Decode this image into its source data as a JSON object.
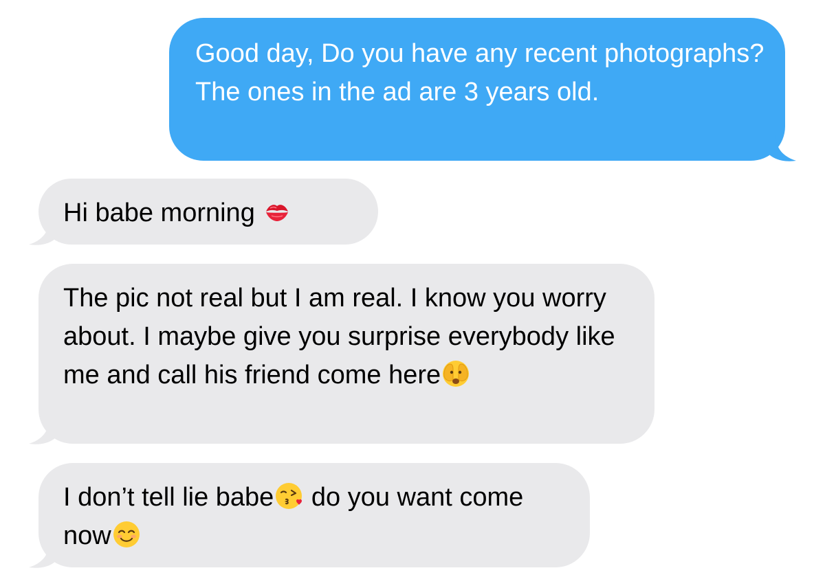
{
  "messages": [
    {
      "direction": "sent",
      "text": "Good day,   Do you have any recent photographs?  The ones in the ad are 3 years old.",
      "trailing_emoji": null
    },
    {
      "direction": "received",
      "text": "Hi babe morning ",
      "trailing_emoji": "kiss-mark-icon"
    },
    {
      "direction": "received",
      "text": "The pic not real but I am real.  I know you worry about. I maybe give you surprise everybody like me and call his friend come here",
      "trailing_emoji": "face-with-open-eyes-and-hand-over-mouth-icon"
    },
    {
      "direction": "received",
      "text_part1": "I don’t tell lie babe",
      "emoji1": "face-blowing-a-kiss-icon",
      "text_part2": " do you want come now",
      "emoji2": "smiling-face-with-smiling-eyes-icon"
    }
  ],
  "colors": {
    "sent_bubble": "#3fa9f5",
    "received_bubble": "#e9e9eb",
    "sent_text": "#ffffff",
    "received_text": "#000000"
  }
}
